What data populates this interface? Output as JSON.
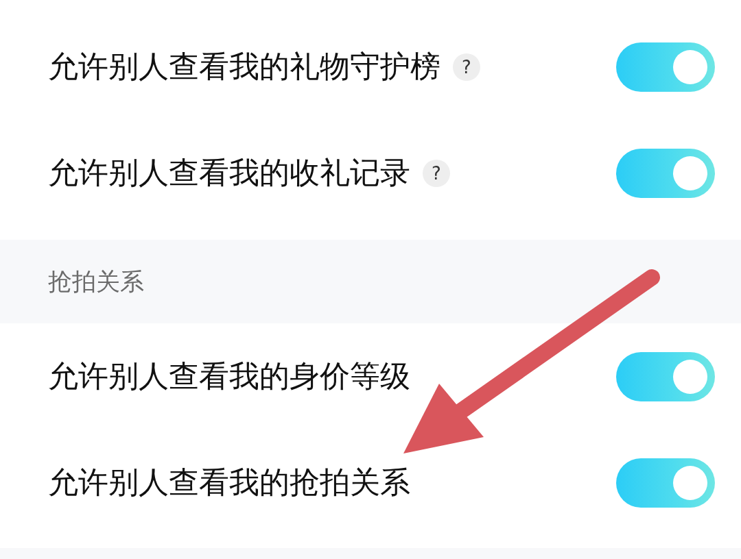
{
  "groups": [
    {
      "rows": [
        {
          "label": "允许别人查看我的礼物守护榜",
          "help": "?",
          "on": true
        },
        {
          "label": "允许别人查看我的收礼记录",
          "help": "?",
          "on": true
        }
      ]
    },
    {
      "title": "抢拍关系",
      "rows": [
        {
          "label": "允许别人查看我的身价等级",
          "on": true
        },
        {
          "label": "允许别人查看我的抢拍关系",
          "on": true
        }
      ]
    }
  ]
}
